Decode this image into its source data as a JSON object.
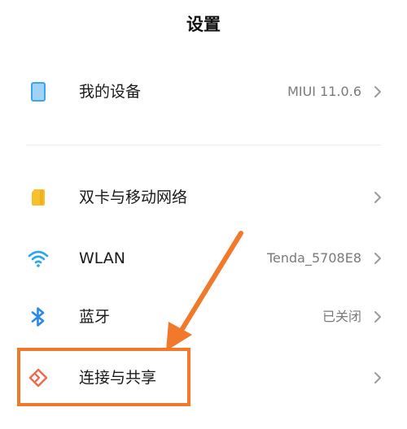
{
  "header": {
    "title": "设置"
  },
  "rows": [
    {
      "label": "我的设备",
      "value": "MIUI 11.0.6",
      "icon": "device-icon"
    },
    {
      "label": "双卡与移动网络",
      "value": "",
      "icon": "sim-card-icon"
    },
    {
      "label": "WLAN",
      "value": "Tenda_5708E8",
      "icon": "wifi-icon"
    },
    {
      "label": "蓝牙",
      "value": "已关闭",
      "icon": "bluetooth-icon"
    },
    {
      "label": "连接与共享",
      "value": "",
      "icon": "share-connect-icon"
    }
  ],
  "colors": {
    "accent_annotation": "#f2782b",
    "wifi": "#2aa5f0",
    "bluetooth": "#2a8ae6",
    "sim": "#f7c12c",
    "device": "#3ea4e8",
    "share": "#f06a4e"
  }
}
